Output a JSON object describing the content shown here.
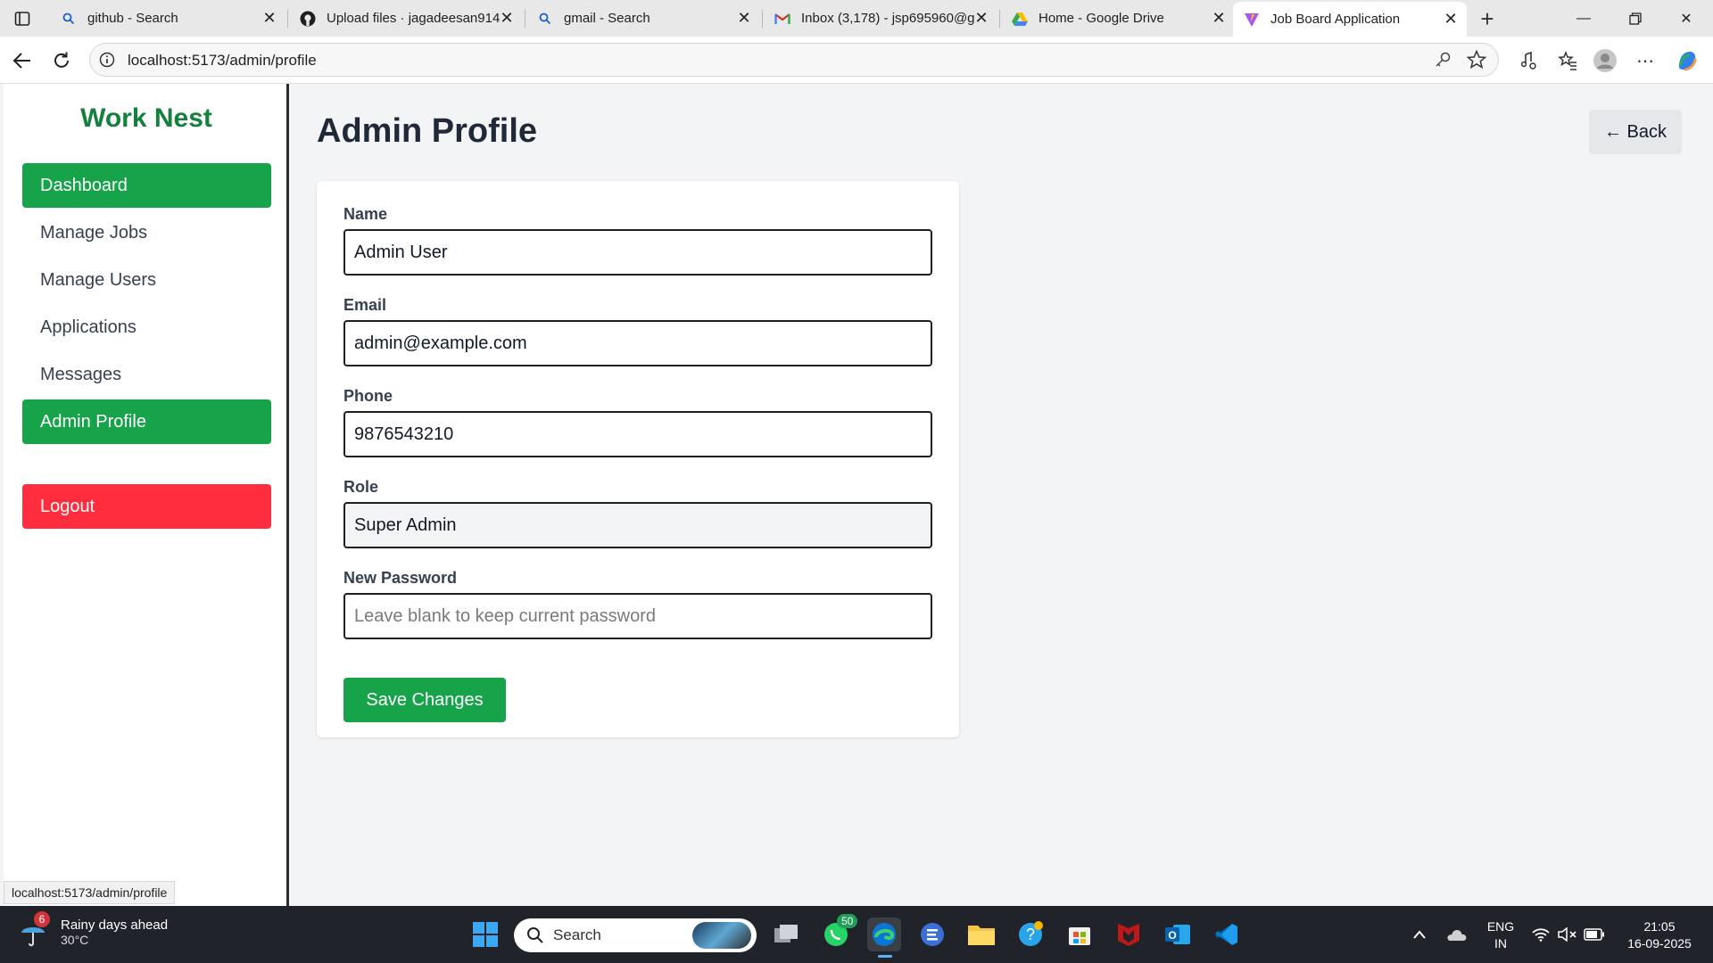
{
  "browser": {
    "tabs": [
      {
        "title": "github - Search",
        "icon": "search-icon"
      },
      {
        "title": "Upload files · jagadeesan914",
        "icon": "github-icon"
      },
      {
        "title": "gmail - Search",
        "icon": "search-icon"
      },
      {
        "title": "Inbox (3,178) - jsp695960@g",
        "icon": "gmail-icon"
      },
      {
        "title": "Home - Google Drive",
        "icon": "google-drive-icon"
      },
      {
        "title": "Job Board Application",
        "icon": "vite-icon"
      }
    ],
    "url": "localhost:5173/admin/profile",
    "status_url": "localhost:5173/admin/profile"
  },
  "app": {
    "brand": "Work Nest",
    "nav": {
      "dashboard": "Dashboard",
      "manage_jobs": "Manage Jobs",
      "manage_users": "Manage Users",
      "applications": "Applications",
      "messages": "Messages",
      "admin_profile": "Admin Profile",
      "logout": "Logout"
    },
    "page_title": "Admin Profile",
    "back_label": "← Back",
    "form": {
      "name_label": "Name",
      "name_value": "Admin User",
      "email_label": "Email",
      "email_value": "admin@example.com",
      "phone_label": "Phone",
      "phone_value": "9876543210",
      "role_label": "Role",
      "role_value": "Super Admin",
      "password_label": "New Password",
      "password_placeholder": "Leave blank to keep current password",
      "save_label": "Save Changes"
    },
    "colors": {
      "brand": "#15803d",
      "active_nav": "#16a34a",
      "logout": "#ff2d3d"
    }
  },
  "taskbar": {
    "weather_badge": "6",
    "weather_text": "Rainy days ahead",
    "temperature": "30°C",
    "search_label": "Search",
    "whatsapp_badge": "50",
    "lang_line1": "ENG",
    "lang_line2": "IN",
    "time": "21:05",
    "date": "16-09-2025"
  }
}
